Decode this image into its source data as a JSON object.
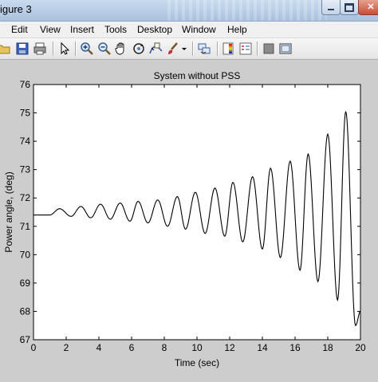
{
  "window": {
    "title": "igure 3"
  },
  "menu": {
    "items": [
      "Edit",
      "View",
      "Insert",
      "Tools",
      "Desktop",
      "Window",
      "Help"
    ]
  },
  "toolbar": {
    "icons": [
      "open-folder-icon",
      "save-icon",
      "print-icon",
      "pointer-icon",
      "zoom-in-icon",
      "zoom-out-icon",
      "pan-hand-icon",
      "rotate-3d-icon",
      "data-cursor-icon",
      "brush-icon",
      "brush-dropdown-icon",
      "link-plot-icon",
      "colorbar-icon",
      "legend-icon",
      "hide-plot-tools-icon",
      "show-plot-tools-icon"
    ]
  },
  "chart_data": {
    "type": "line",
    "title": "System without PSS",
    "xlabel": "Time (sec)",
    "ylabel": "Power angle, (deg)",
    "xlim": [
      0,
      20
    ],
    "ylim": [
      67,
      76
    ],
    "xticks": [
      0,
      2,
      4,
      6,
      8,
      10,
      12,
      14,
      16,
      18,
      20
    ],
    "yticks": [
      67,
      68,
      69,
      70,
      71,
      72,
      73,
      74,
      75,
      76
    ],
    "xtick_labels": [
      "0",
      "2",
      "4",
      "6",
      "8",
      "10",
      "12",
      "14",
      "16",
      "18",
      "20"
    ],
    "ytick_labels": [
      "67",
      "68",
      "69",
      "70",
      "71",
      "72",
      "73",
      "74",
      "75",
      "76"
    ],
    "grid": false,
    "series": [
      {
        "color": "#000000",
        "x": [
          0,
          1.0,
          1.6,
          2.3,
          2.9,
          3.5,
          4.1,
          4.7,
          5.3,
          5.9,
          6.4,
          7.0,
          7.6,
          8.2,
          8.8,
          9.3,
          9.9,
          10.5,
          11.1,
          11.7,
          12.2,
          12.8,
          13.4,
          14.0,
          14.5,
          15.1,
          15.7,
          16.3,
          16.8,
          17.4,
          18.0,
          18.6,
          19.1,
          19.7,
          20.0
        ],
        "y": [
          71.4,
          71.4,
          71.62,
          71.35,
          71.7,
          71.3,
          71.78,
          71.25,
          71.82,
          71.18,
          71.88,
          71.12,
          71.93,
          71.0,
          72.05,
          70.9,
          72.2,
          70.75,
          72.35,
          70.65,
          72.55,
          70.45,
          72.75,
          70.2,
          73.05,
          69.9,
          73.3,
          69.45,
          73.55,
          69.05,
          74.25,
          68.4,
          75.05,
          67.5,
          68.0
        ]
      }
    ]
  }
}
